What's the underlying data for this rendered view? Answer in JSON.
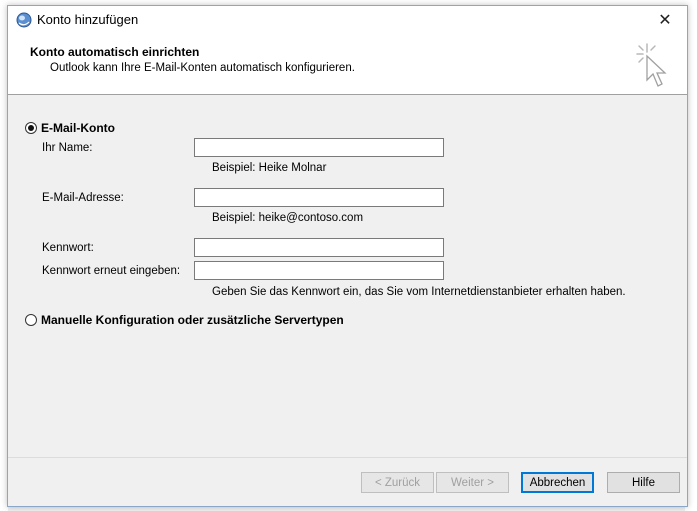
{
  "window": {
    "title": "Konto hinzufügen",
    "close_label": "✕"
  },
  "header": {
    "title": "Konto automatisch einrichten",
    "subtitle": "Outlook kann Ihre E-Mail-Konten automatisch konfigurieren."
  },
  "options": {
    "email_account": {
      "label": "E-Mail-Konto",
      "selected": true
    },
    "manual_config": {
      "label": "Manuelle Konfiguration oder zusätzliche Servertypen",
      "selected": false
    }
  },
  "form": {
    "name": {
      "label": "Ihr Name:",
      "value": "",
      "hint": "Beispiel: Heike Molnar"
    },
    "email": {
      "label": "E-Mail-Adresse:",
      "value": "",
      "hint": "Beispiel: heike@contoso.com"
    },
    "password": {
      "label": "Kennwort:",
      "value": ""
    },
    "password_repeat": {
      "label": "Kennwort erneut eingeben:",
      "value": "",
      "hint": "Geben Sie das Kennwort ein, das Sie vom Internetdienstanbieter erhalten haben."
    }
  },
  "buttons": {
    "back": "< Zurück",
    "next": "Weiter >",
    "cancel": "Abbrechen",
    "help": "Hilfe"
  },
  "colors": {
    "default_button_border": "#0078d7",
    "disabled_text": "#a0a0a0"
  },
  "icons": {
    "app": "outlook-icon",
    "wizard": "wizard-cursor-icon",
    "close": "close-icon"
  }
}
